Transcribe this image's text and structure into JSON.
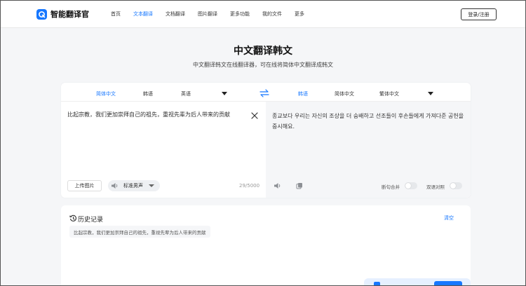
{
  "brand": {
    "name": "智能翻译官",
    "accent": "#1677ff"
  },
  "nav": [
    "首页",
    "文本翻译",
    "文档翻译",
    "图片翻译",
    "更多功能",
    "我的文件",
    "更多"
  ],
  "nav_active": "文本翻译",
  "header": {
    "login_label": "登录/注册"
  },
  "hero": {
    "title": "中文翻译韩文",
    "subtitle": "中文翻译韩文在线翻译器，可在线将简体中文翻译成韩文"
  },
  "translator": {
    "source_langs": [
      "简体中文",
      "韩语",
      "英语"
    ],
    "source_active": "简体中文",
    "target_langs": [
      "韩语",
      "简体中文",
      "繁体中文"
    ],
    "target_active": "韩语",
    "source_text": "比起宗教，我们更加崇拜自己的祖先，重视先辈为后人带来的贡献",
    "target_text": "종교보다 우리는 자신의 조상을 더 숭배하고 선조들이 후손들에게 가져다준 공헌을 중시해요.",
    "upload_label": "上传图片",
    "voice_label": "标准男声",
    "char_count": "29/5000",
    "toggle_sentence_merge": "断句合并",
    "toggle_bilingual": "双语对照"
  },
  "history": {
    "title": "历史记录",
    "clear_label": "清空",
    "items": [
      "比起宗教，我们更加崇拜自己的祖先，重视先辈为后人带来的贡献"
    ]
  },
  "icons": [
    "app-logo-icon",
    "swap-icon",
    "clear-icon",
    "speaker-icon",
    "copy-icon",
    "history-icon"
  ]
}
